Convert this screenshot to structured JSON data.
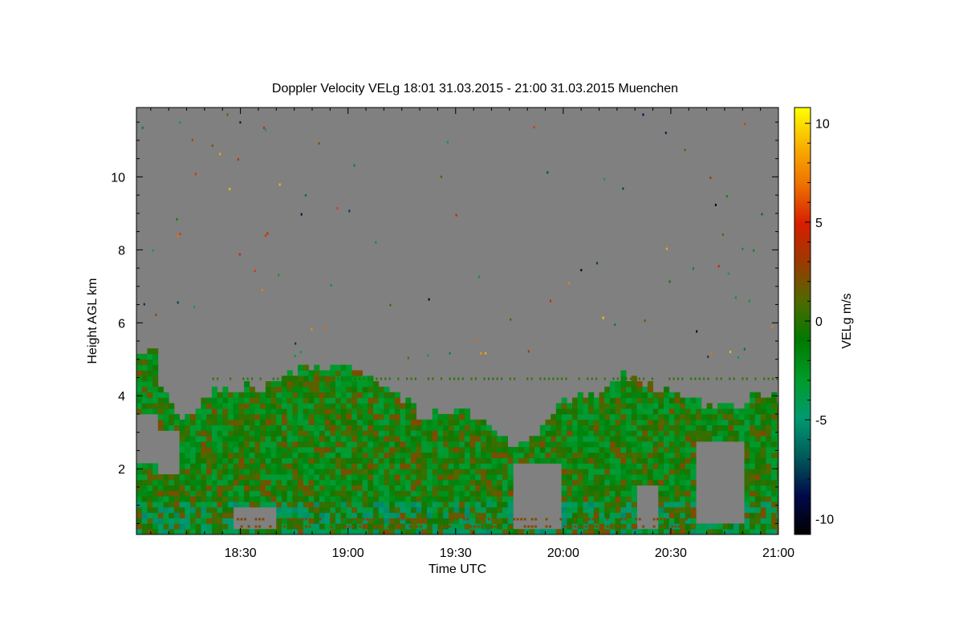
{
  "chart_data": {
    "type": "heatmap",
    "title": "Doppler Velocity VELg   18:01 31.03.2015 - 21:00 31.03.2015 Muenchen",
    "xlabel": "Time UTC",
    "ylabel": "Height AGL km",
    "x_range_minutes_utc": [
      1081,
      1260
    ],
    "x_ticks": [
      {
        "label": "18:30",
        "minute": 1110
      },
      {
        "label": "19:00",
        "minute": 1140
      },
      {
        "label": "19:30",
        "minute": 1170
      },
      {
        "label": "20:00",
        "minute": 1200
      },
      {
        "label": "20:30",
        "minute": 1230
      },
      {
        "label": "21:00",
        "minute": 1260
      }
    ],
    "y_range_km": [
      0.2,
      11.9
    ],
    "y_ticks": [
      {
        "label": "2",
        "value": 2
      },
      {
        "label": "4",
        "value": 4
      },
      {
        "label": "6",
        "value": 6
      },
      {
        "label": "8",
        "value": 8
      },
      {
        "label": "10",
        "value": 10
      }
    ],
    "colorbar": {
      "label": "VELg m/s",
      "range": [
        -10.8,
        10.8
      ],
      "ticks": [
        {
          "label": "10",
          "value": 10
        },
        {
          "label": "5",
          "value": 5
        },
        {
          "label": "0",
          "value": 0
        },
        {
          "label": "-5",
          "value": -5
        },
        {
          "label": "-10",
          "value": -10
        }
      ],
      "stops": [
        "#000000",
        "#000a4b",
        "#005a5a",
        "#009a70",
        "#009b2a",
        "#007a00",
        "#4d6a00",
        "#9a3a00",
        "#d61e00",
        "#ee7000",
        "#f8b000",
        "#ffff00"
      ]
    },
    "background_color": "#808080",
    "cloud_top_km": [
      {
        "t": 1081,
        "top": 5.1
      },
      {
        "t": 1086,
        "top": 5.2
      },
      {
        "t": 1087,
        "top": 4.2
      },
      {
        "t": 1093,
        "top": 3.2
      },
      {
        "t": 1100,
        "top": 3.8
      },
      {
        "t": 1105,
        "top": 4.2
      },
      {
        "t": 1112,
        "top": 4.1
      },
      {
        "t": 1120,
        "top": 4.3
      },
      {
        "t": 1125,
        "top": 4.7
      },
      {
        "t": 1133,
        "top": 4.6
      },
      {
        "t": 1139,
        "top": 4.9
      },
      {
        "t": 1146,
        "top": 4.3
      },
      {
        "t": 1153,
        "top": 4.0
      },
      {
        "t": 1160,
        "top": 3.4
      },
      {
        "t": 1170,
        "top": 3.6
      },
      {
        "t": 1178,
        "top": 3.3
      },
      {
        "t": 1186,
        "top": 2.6
      },
      {
        "t": 1193,
        "top": 3.0
      },
      {
        "t": 1196,
        "top": 3.4
      },
      {
        "t": 1200,
        "top": 3.9
      },
      {
        "t": 1210,
        "top": 4.0
      },
      {
        "t": 1216,
        "top": 4.5
      },
      {
        "t": 1222,
        "top": 4.3
      },
      {
        "t": 1230,
        "top": 4.0
      },
      {
        "t": 1238,
        "top": 3.8
      },
      {
        "t": 1246,
        "top": 3.6
      },
      {
        "t": 1253,
        "top": 4.0
      },
      {
        "t": 1260,
        "top": 3.9
      }
    ],
    "clear_gaps": [
      {
        "t0": 1081,
        "t1": 1087,
        "bottom": 2.1,
        "top": 3.4
      },
      {
        "t0": 1087,
        "t1": 1093,
        "bottom": 1.8,
        "top": 3.0
      },
      {
        "t0": 1108,
        "t1": 1120,
        "bottom": 0.25,
        "top": 0.8
      },
      {
        "t0": 1185,
        "t1": 1199,
        "bottom": 0.25,
        "top": 2.0
      },
      {
        "t0": 1220,
        "t1": 1226,
        "bottom": 0.25,
        "top": 1.5
      },
      {
        "t0": 1237,
        "t1": 1250,
        "bottom": 0.5,
        "top": 2.6
      }
    ]
  }
}
